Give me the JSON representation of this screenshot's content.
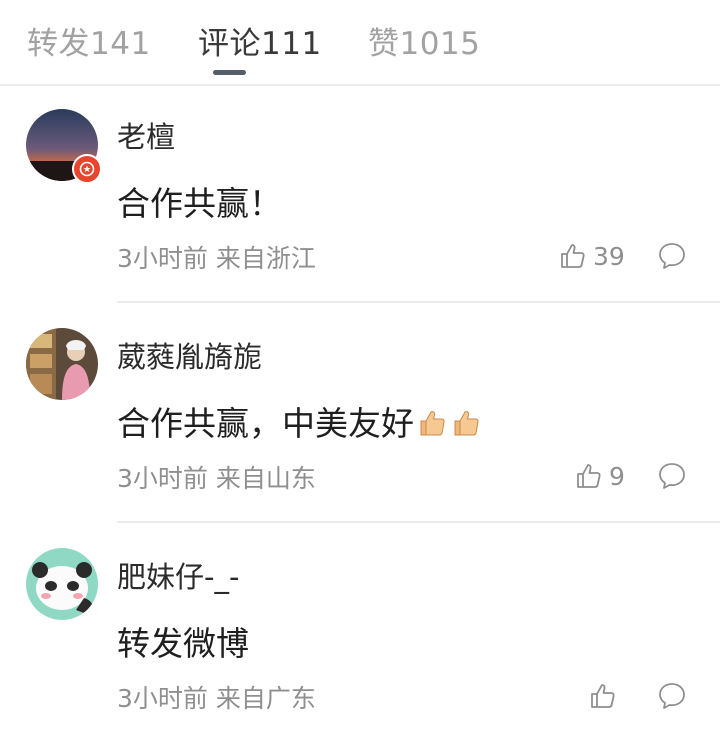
{
  "tabs": [
    {
      "label": "转发141",
      "active": false
    },
    {
      "label": "评论111",
      "active": true
    },
    {
      "label": "赞1015",
      "active": false
    }
  ],
  "comments": [
    {
      "username": "老檀",
      "text": "合作共赢！",
      "time": "3小时前",
      "source": "来自浙江",
      "likes": "39",
      "verified_badge": true
    },
    {
      "username": "葳蕤胤旖旎",
      "text": "合作共赢，中美友好",
      "emojis": [
        "thumbs-up-emoji",
        "thumbs-up-emoji"
      ],
      "time": "3小时前",
      "source": "来自山东",
      "likes": "9"
    },
    {
      "username": "肥妹仔-_-",
      "text": "转发微博",
      "time": "3小时前",
      "source": "来自广东",
      "likes": ""
    }
  ],
  "icons": [
    "like-icon",
    "reply-icon",
    "verified-badge-icon"
  ],
  "colors": {
    "active_tab": "#3a3a3a",
    "inactive_tab": "#a2a2a2",
    "meta": "#8f8f8f",
    "badge": "#e8452f"
  }
}
